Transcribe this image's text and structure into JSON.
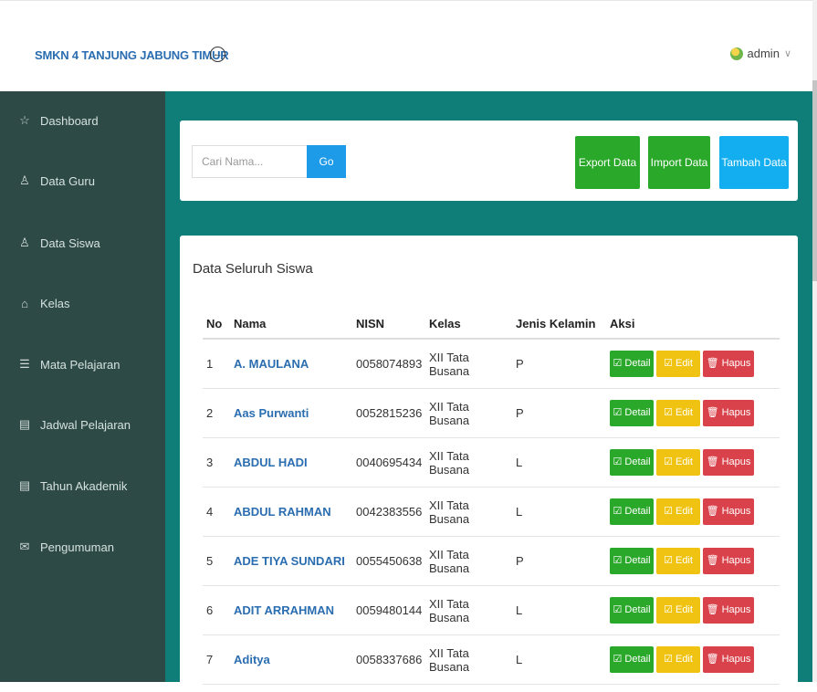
{
  "header": {
    "brand": "SMKN 4 TANJUNG JABUNG TIMUR",
    "toggle_icon": "←",
    "user_name": "admin",
    "caret": "∨"
  },
  "sidebar": {
    "items": [
      {
        "label": "Dashboard",
        "icon": "☆"
      },
      {
        "label": "Data Guru",
        "icon": "♙"
      },
      {
        "label": "Data Siswa",
        "icon": "♙"
      },
      {
        "label": "Kelas",
        "icon": "⌂"
      },
      {
        "label": "Mata Pelajaran",
        "icon": "☰"
      },
      {
        "label": "Jadwal Pelajaran",
        "icon": "▤"
      },
      {
        "label": "Tahun Akademik",
        "icon": "▤"
      },
      {
        "label": "Pengumuman",
        "icon": "✉"
      }
    ]
  },
  "toolbar": {
    "search_placeholder": "Cari Nama...",
    "go_label": "Go",
    "export_label": "Export Data",
    "import_label": "Import Data",
    "add_label": "Tambah Data"
  },
  "students": {
    "title": "Data Seluruh Siswa",
    "columns": {
      "no": "No",
      "nama": "Nama",
      "nisn": "NISN",
      "kelas": "Kelas",
      "jk": "Jenis Kelamin",
      "aksi": "Aksi"
    },
    "actions": {
      "detail": "☑ Detail",
      "edit": "☑ Edit",
      "hapus": "🗑 Hapus"
    },
    "rows": [
      {
        "no": "1",
        "nama": "A. MAULANA",
        "nisn": "0058074893",
        "kelas": "XII Tata Busana",
        "jk": "P"
      },
      {
        "no": "2",
        "nama": "Aas Purwanti",
        "nisn": "0052815236",
        "kelas": "XII Tata Busana",
        "jk": "P"
      },
      {
        "no": "3",
        "nama": "ABDUL HADI",
        "nisn": "0040695434",
        "kelas": "XII Tata Busana",
        "jk": "L"
      },
      {
        "no": "4",
        "nama": "ABDUL RAHMAN",
        "nisn": "0042383556",
        "kelas": "XII Tata Busana",
        "jk": "L"
      },
      {
        "no": "5",
        "nama": "ADE TIYA SUNDARI",
        "nisn": "0055450638",
        "kelas": "XII Tata Busana",
        "jk": "P"
      },
      {
        "no": "6",
        "nama": "ADIT ARRAHMAN",
        "nisn": "0059480144",
        "kelas": "XII Tata Busana",
        "jk": "L"
      },
      {
        "no": "7",
        "nama": "Aditya",
        "nisn": "0058337686",
        "kelas": "XII Tata Busana",
        "jk": "L"
      }
    ]
  }
}
